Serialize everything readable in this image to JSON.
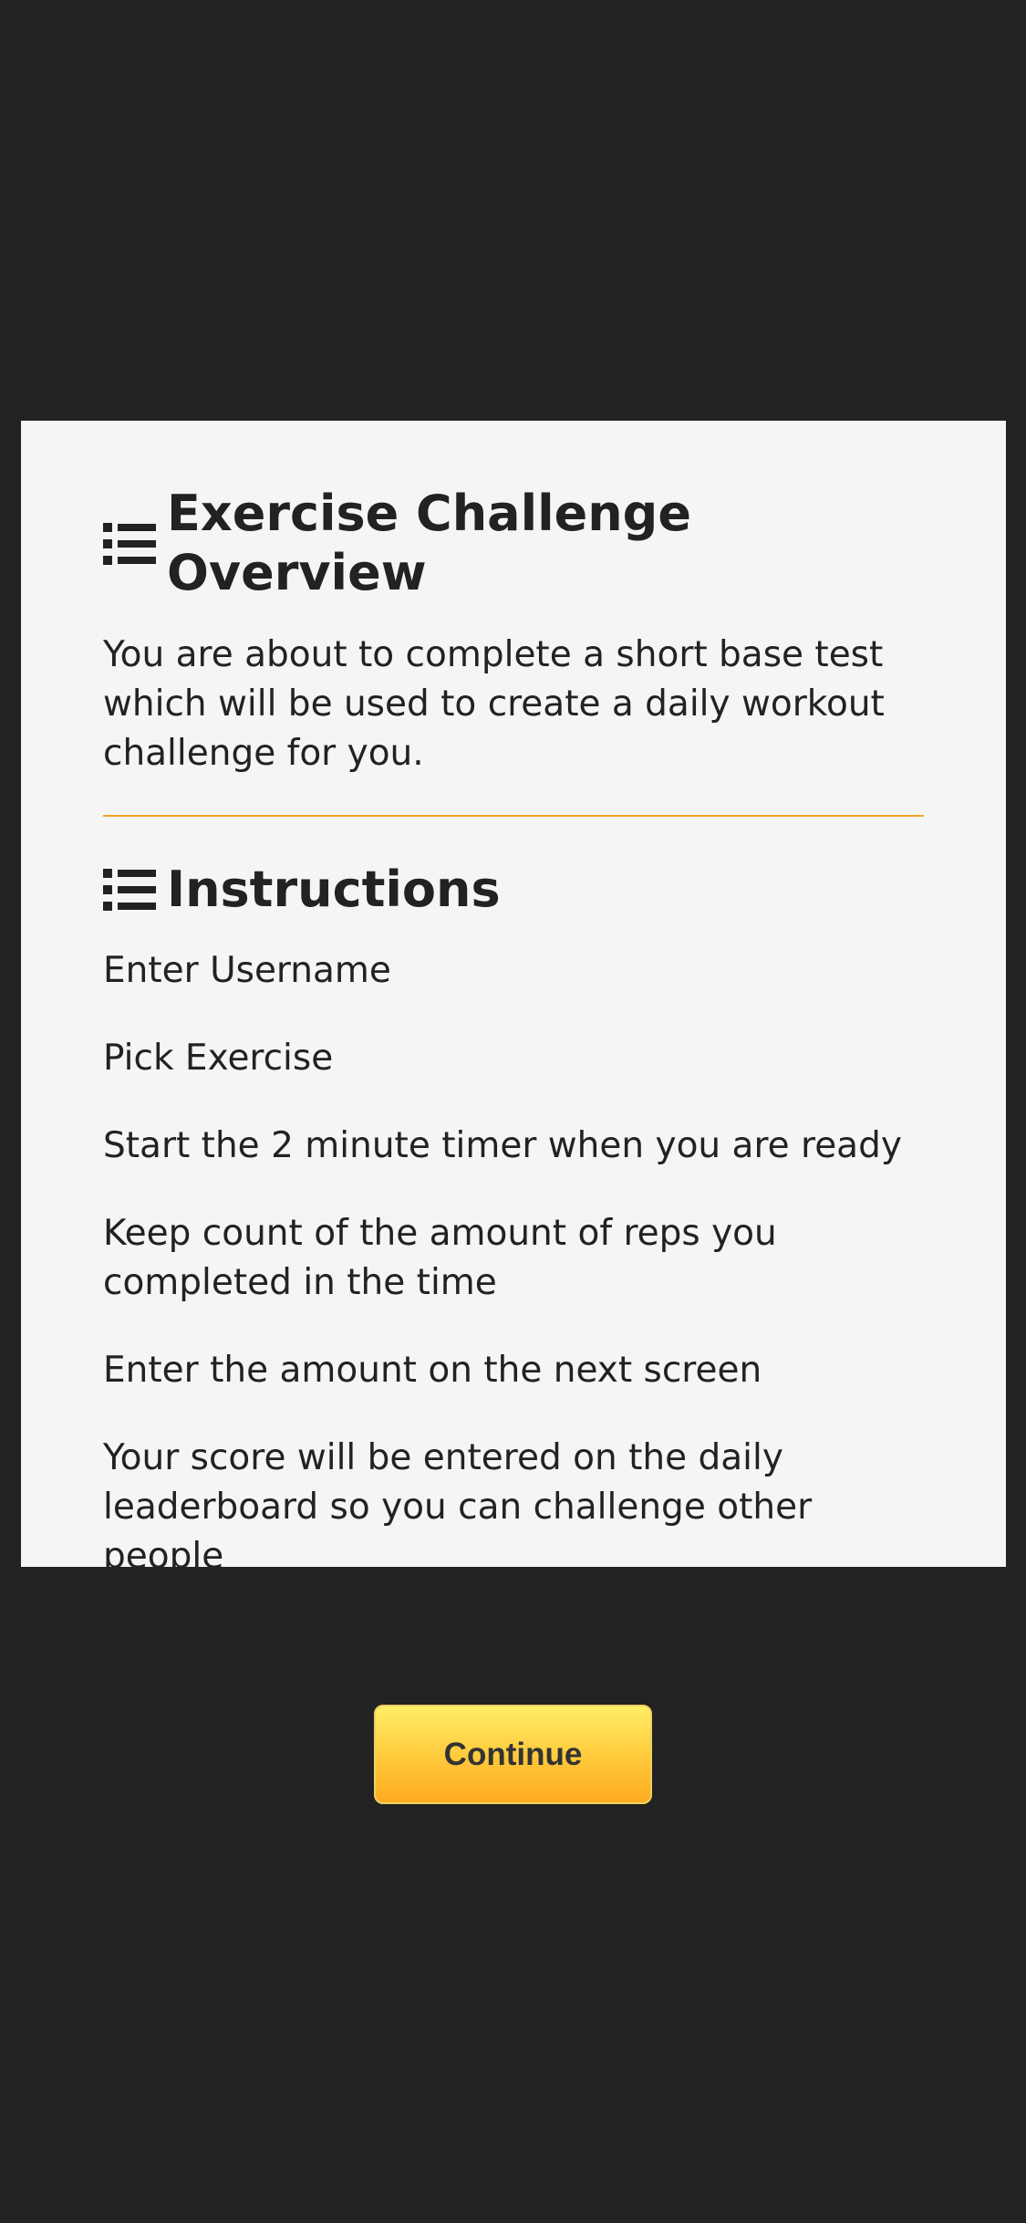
{
  "overview": {
    "title": "Exercise Challenge Overview",
    "icon": "list-icon",
    "description": "You are about to complete a short base test which will be used to create a daily workout challenge for you."
  },
  "instructions": {
    "title": "Instructions",
    "icon": "list-icon",
    "steps": [
      "Enter Username",
      "Pick Exercise",
      "Start the 2 minute timer when you are ready",
      "Keep count of the amount of reps you completed in the time",
      "Enter the amount on the next screen",
      "Your score will be entered on the daily leaderboard so you can challenge other people"
    ]
  },
  "actions": {
    "continue_label": "Continue"
  },
  "colors": {
    "background": "#222222",
    "card": "#f5f5f5",
    "divider": "#f5a623",
    "button_top": "#ffee66",
    "button_bottom": "#ffab22"
  }
}
